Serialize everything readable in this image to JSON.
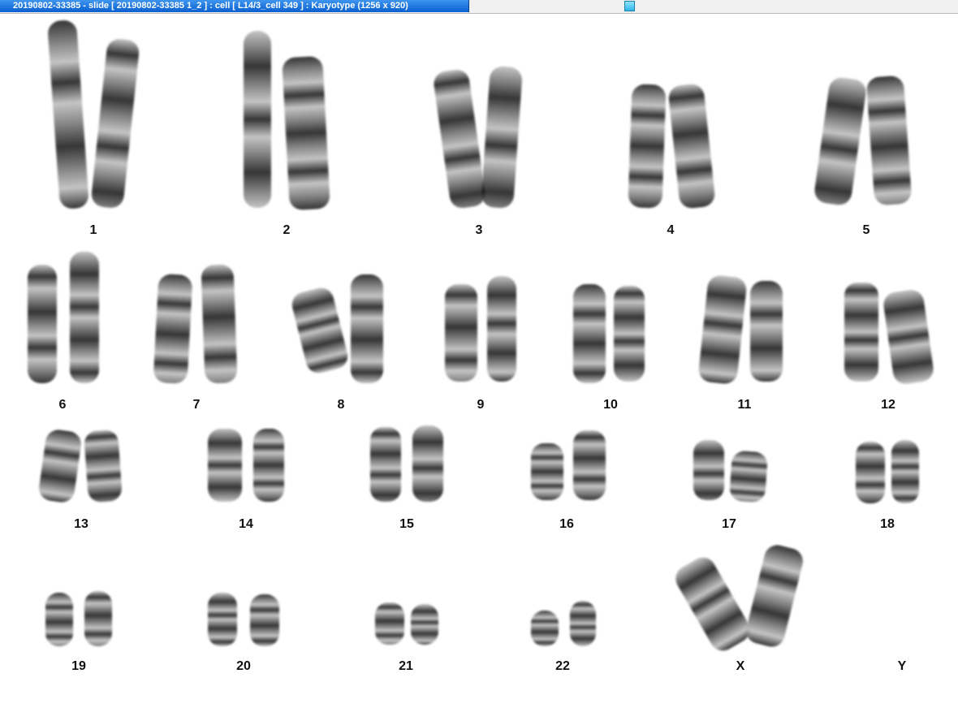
{
  "window": {
    "title": "20190802-33385 - slide [ 20190802-33385 1_2 ] : cell [ L14/3_cell 349 ] : Karyotype  (1256 x 920)"
  },
  "colors": {
    "title_bar": "#0a5fcf",
    "background": "#ffffff",
    "chromosome_dark": "#1a1a1a",
    "chromosome_light": "#bdbdbd"
  },
  "karyotype": {
    "chromosomes": [
      {
        "label": "1"
      },
      {
        "label": "2"
      },
      {
        "label": "3"
      },
      {
        "label": "4"
      },
      {
        "label": "5"
      },
      {
        "label": "6"
      },
      {
        "label": "7"
      },
      {
        "label": "8"
      },
      {
        "label": "9"
      },
      {
        "label": "10"
      },
      {
        "label": "11"
      },
      {
        "label": "12"
      },
      {
        "label": "13"
      },
      {
        "label": "14"
      },
      {
        "label": "15"
      },
      {
        "label": "16"
      },
      {
        "label": "17"
      },
      {
        "label": "18"
      },
      {
        "label": "19"
      },
      {
        "label": "20"
      },
      {
        "label": "21"
      },
      {
        "label": "22"
      },
      {
        "label": "X"
      },
      {
        "label": "Y"
      }
    ]
  }
}
